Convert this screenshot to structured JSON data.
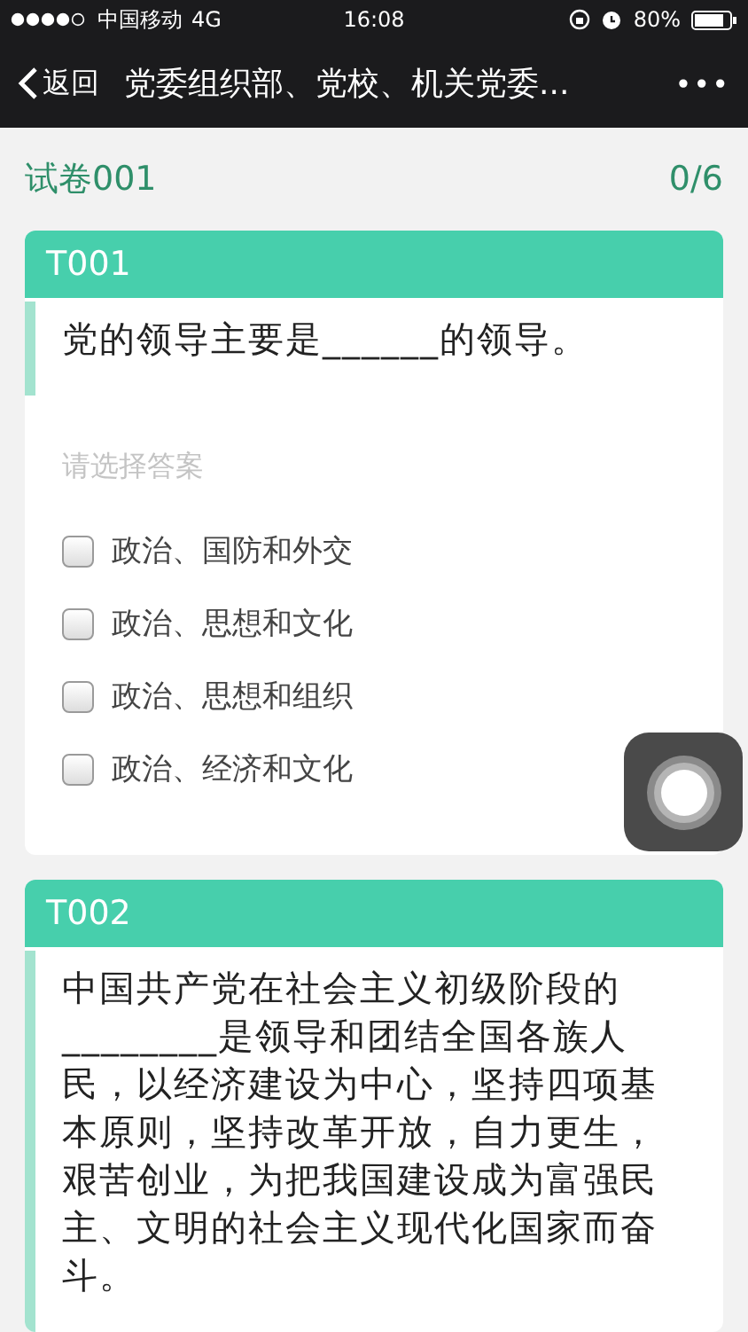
{
  "status_bar": {
    "carrier": "中国移动",
    "network": "4G",
    "time": "16:08",
    "battery": "80%"
  },
  "nav_bar": {
    "back": "返回",
    "title": "党委组织部、党校、机关党委...",
    "more": "•••"
  },
  "paper": {
    "title": "试卷001",
    "progress": "0/6"
  },
  "questions": [
    {
      "code": "T001",
      "text": "党的领导主要是______的领导。",
      "prompt": "请选择答案",
      "options": [
        {
          "label": "政治、国防和外交",
          "checked": false
        },
        {
          "label": "政治、思想和文化",
          "checked": false
        },
        {
          "label": "政治、思想和组织",
          "checked": false
        },
        {
          "label": "政治、经济和文化",
          "checked": false
        }
      ]
    },
    {
      "code": "T002",
      "text": "中国共产党在社会主义初级阶段的________是领导和团结全国各族人民，以经济建设为中心，坚持四项基本原则，坚持改革开放，自力更生，艰苦创业，为把我国建设成为富强民主、文明的社会主义现代化国家而奋斗。"
    }
  ]
}
